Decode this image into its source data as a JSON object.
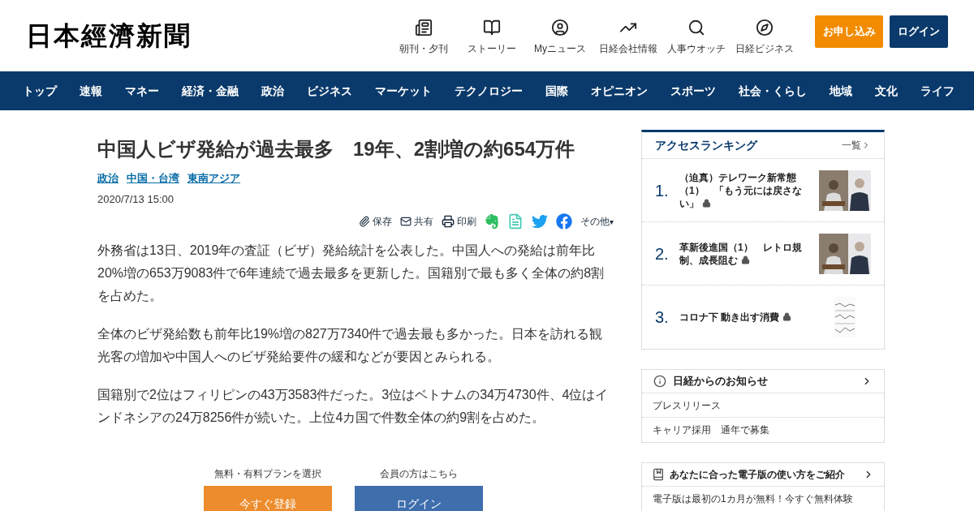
{
  "header": {
    "logo": "日本經濟新聞",
    "shortcuts": [
      {
        "kind": "paper",
        "label": "朝刊・夕刊"
      },
      {
        "kind": "story",
        "label": "ストーリー"
      },
      {
        "kind": "my",
        "label": "Myニュース"
      },
      {
        "kind": "company",
        "label": "日経会社情報"
      },
      {
        "kind": "people",
        "label": "人事ウオッチ"
      },
      {
        "kind": "business",
        "label": "日経ビジネス"
      }
    ],
    "subscribe": "お申し込み",
    "login": "ログイン"
  },
  "nav": [
    "トップ",
    "速報",
    "マネー",
    "経済・金融",
    "政治",
    "ビジネス",
    "マーケット",
    "テクノロジー",
    "国際",
    "オピニオン",
    "スポーツ",
    "社会・くらし",
    "地域",
    "文化",
    "ライフ"
  ],
  "article": {
    "title": "中国人ビザ発給が過去最多　19年、2割増の約654万件",
    "tags": [
      "政治",
      "中国・台湾",
      "東南アジア"
    ],
    "date": "2020/7/13 15:00",
    "share": [
      {
        "kind": "save",
        "label": "保存"
      },
      {
        "kind": "mail",
        "label": "共有"
      },
      {
        "kind": "print",
        "label": "印刷"
      },
      {
        "kind": "evernote"
      },
      {
        "kind": "note"
      },
      {
        "kind": "twitter"
      },
      {
        "kind": "facebook"
      },
      {
        "kind": "more",
        "label": "その他",
        "caret": "▾"
      }
    ],
    "paragraphs": [
      "外務省は13日、2019年の査証（ビザ）発給統計を公表した。中国人への発給は前年比20%増の653万9083件で6年連続で過去最多を更新した。国籍別で最も多く全体の約8割を占めた。",
      "全体のビザ発給数も前年比19%増の827万7340件で過去最も多かった。日本を訪れる観光客の増加や中国人へのビザ発給要件の緩和などが要因とみられる。",
      "国籍別で2位はフィリピンの43万3583件だった。3位はベトナムの34万4730件、4位はインドネシアの24万8256件が続いた。上位4カ国で件数全体の約9割を占めた。"
    ],
    "cta": [
      {
        "kind": "register",
        "caption": "無料・有料プランを選択",
        "button": "今すぐ登録"
      },
      {
        "kind": "login",
        "caption": "会員の方はこちら",
        "button": "ログイン"
      }
    ]
  },
  "ranking": {
    "title": "アクセスランキング",
    "more": "一覧",
    "items": [
      {
        "rank": "1.",
        "title": "（迫真）テレワーク新常態（1）　「もう元には戻さない」",
        "locked": true
      },
      {
        "rank": "2.",
        "title": "革新後進国（1）　レトロ規制、成長阻む",
        "locked": true
      },
      {
        "rank": "3.",
        "title": "コロナ下 動き出す消費",
        "locked": true
      }
    ]
  },
  "notices": {
    "title": "日経からのお知らせ",
    "items": [
      "プレスリリース",
      "キャリア採用　通年で募集"
    ]
  },
  "guide": {
    "title": "あなたに合った電子版の使い方をご紹介",
    "items": [
      "電子版は最初の1カ月が無料！今すぐ無料体験"
    ]
  }
}
